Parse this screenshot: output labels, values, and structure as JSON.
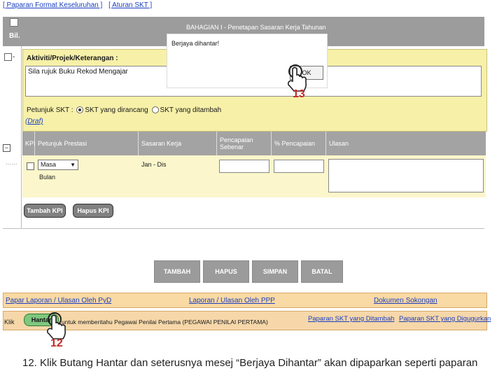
{
  "top_links": {
    "paparan_format": "[ Paparan Format Keseluruhan ]",
    "aturan": "[ Aturan SKT ]"
  },
  "header": {
    "bil": "Bil.",
    "title": "BAHAGIAN I - Penetapan Sasaran Kerja Tahunan"
  },
  "activity": {
    "label": "Aktiviti/Projek/Keterangan :",
    "value": "Sila rujuk Buku Rekod Mengajar",
    "petunjuk_label": "Petunjuk SKT :",
    "radio1": "SKT yang dirancang",
    "radio2": "SKT yang ditambah",
    "draf": "(Draf)"
  },
  "kpi_table": {
    "headers": [
      "KPI",
      "Petunjuk Prestasi",
      "Sasaran Kerja",
      "Pencapaian Sebenar",
      "% Pencapaian",
      "Ulasan"
    ],
    "row": {
      "select_value": "Masa",
      "unit": "Bulan",
      "sasaran": "Jan - Dis"
    }
  },
  "kpi_buttons": {
    "tambah_kpi": "Tambah KPI",
    "hapus_kpi": "Hapus KPI"
  },
  "main_buttons": {
    "tambah": "TAMBAH",
    "hapus": "HAPUS",
    "simpan": "SIMPAN",
    "batal": "BATAL"
  },
  "bottom_links": {
    "paparan_laporan_pyd": "Papar Laporan / Ulasan Oleh PyD",
    "laporan_ppp": "Laporan / Ulasan Oleh PPP",
    "dokumen_sokongan": "Dokumen Sokongan",
    "klik": "Klik",
    "hantar_text": "untuk memberitahu Pegawai Penilai Pertama (PEGAWAI PENILAI PERTAMA)",
    "paparan_ditambah": "Paparan SKT yang Ditambah",
    "paparan_digugurkan": "Paparan SKT yang Digugurkan"
  },
  "hantar_button": "Hantar",
  "dialog": {
    "message": "Berjaya dihantar!",
    "ok": "OK"
  },
  "annotations": {
    "step12": "12",
    "step13": "13"
  },
  "caption": "12. Klik Butang Hantar dan seterusnya mesej “Berjaya Dihantar” akan dipaparkan seperti paparan",
  "colors": {
    "header_gray": "#9c9c9c",
    "yellow": "#f7f0a8",
    "orange": "#f9d9a4",
    "link_blue": "#1a3fbf",
    "annotation_red": "#c62828",
    "hantar_green": "#7fc77f"
  }
}
